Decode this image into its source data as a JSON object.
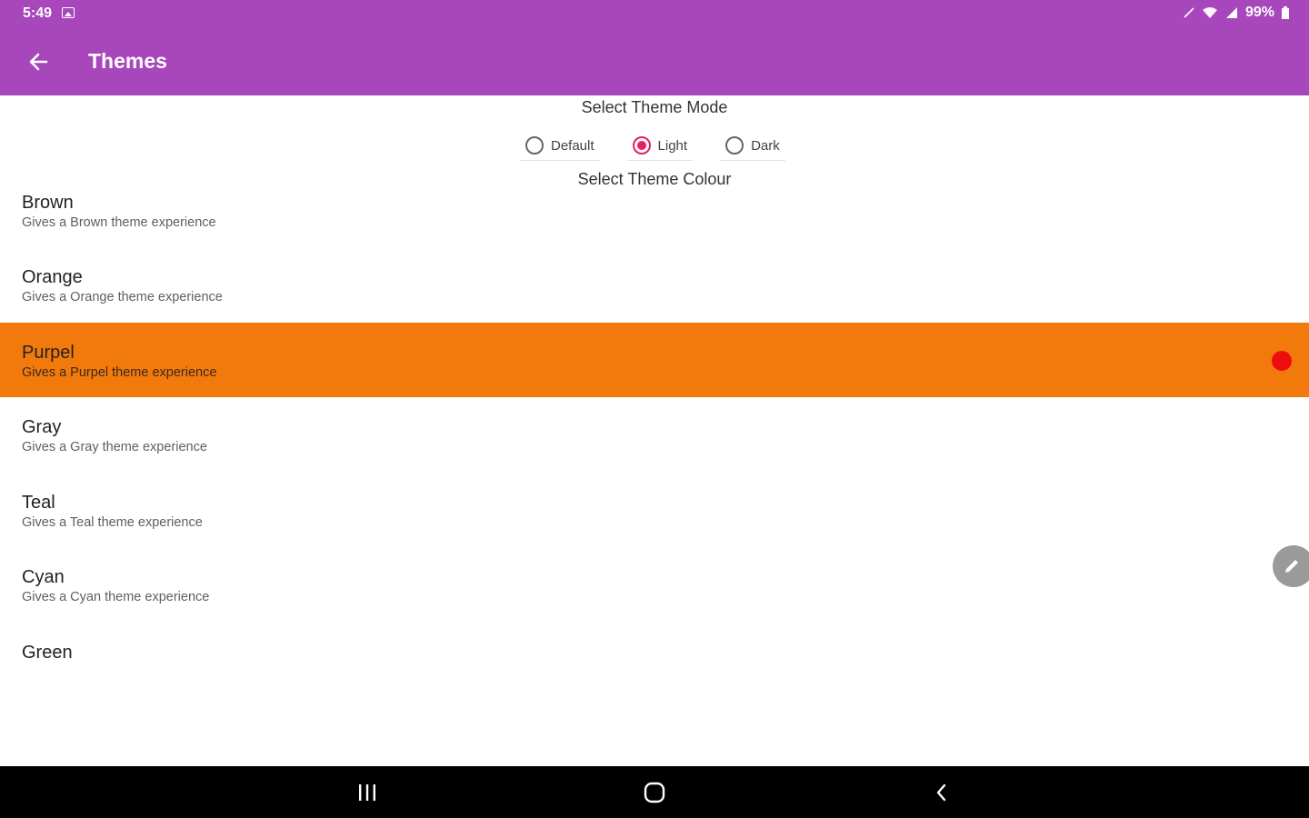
{
  "status_bar": {
    "time": "5:49",
    "battery": "99%",
    "icons": [
      "image-icon",
      "pen-icon",
      "wifi-icon",
      "signal-icon",
      "battery-icon"
    ]
  },
  "toolbar": {
    "title": "Themes",
    "back_icon": "arrow-left-icon",
    "color": "#a846bb"
  },
  "theme_mode": {
    "heading": "Select Theme Mode",
    "options": [
      {
        "label": "Default",
        "checked": false
      },
      {
        "label": "Light",
        "checked": true
      },
      {
        "label": "Dark",
        "checked": false
      }
    ],
    "accent": "#e91e63"
  },
  "theme_colour": {
    "heading": "Select Theme Colour",
    "selected_color": "#f27a0d",
    "items": [
      {
        "title": "Brown",
        "subtitle": "Gives a Brown theme experience"
      },
      {
        "title": "Orange",
        "subtitle": "Gives a Orange theme experience"
      },
      {
        "title": "Purpel",
        "subtitle": "Gives a Purpel theme experience",
        "selected": true
      },
      {
        "title": "Gray",
        "subtitle": "Gives a Gray theme experience"
      },
      {
        "title": "Teal",
        "subtitle": "Gives a Teal theme experience"
      },
      {
        "title": "Cyan",
        "subtitle": "Gives a Cyan  theme experience"
      },
      {
        "title": "Green",
        "subtitle": ""
      }
    ]
  },
  "fab": {
    "icon": "pencil-icon"
  },
  "nav_bar": {
    "buttons": [
      "recent-apps-icon",
      "home-icon",
      "back-icon"
    ]
  }
}
